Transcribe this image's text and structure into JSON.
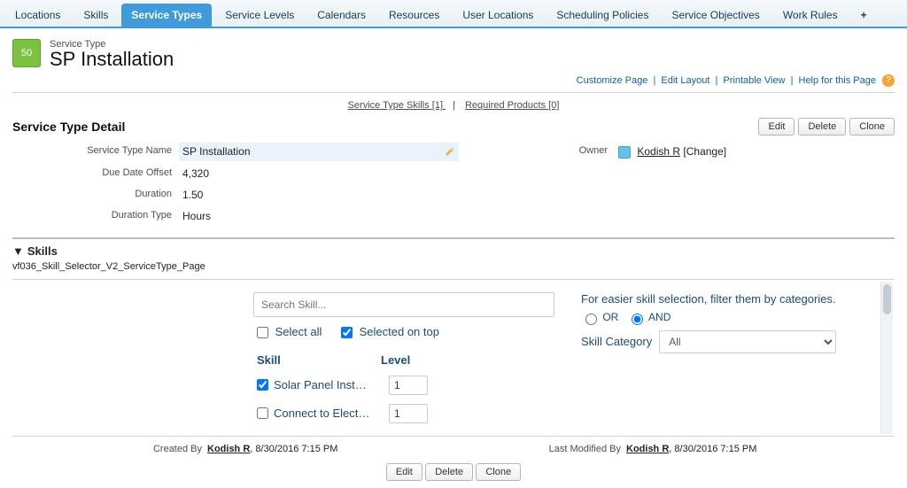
{
  "tabs": [
    "Locations",
    "Skills",
    "Service Types",
    "Service Levels",
    "Calendars",
    "Resources",
    "User Locations",
    "Scheduling Policies",
    "Service Objectives",
    "Work Rules",
    "+"
  ],
  "active_tab_index": 2,
  "record": {
    "object_label": "Service Type",
    "title": "SP Installation",
    "icon_text": "50"
  },
  "util_links": {
    "customize": "Customize Page",
    "edit_layout": "Edit Layout",
    "printable": "Printable View",
    "help": "Help for this Page"
  },
  "related_links": {
    "skills": {
      "label": "Service Type Skills",
      "count": "[1]"
    },
    "products": {
      "label": "Required Products",
      "count": "[0]"
    }
  },
  "section": {
    "title": "Service Type Detail"
  },
  "buttons": {
    "edit": "Edit",
    "delete": "Delete",
    "clone": "Clone"
  },
  "fields": {
    "name_label": "Service Type Name",
    "name_value": "SP Installation",
    "due_label": "Due Date Offset",
    "due_value": "4,320",
    "duration_label": "Duration",
    "duration_value": "1.50",
    "durtype_label": "Duration Type",
    "durtype_value": "Hours",
    "owner_label": "Owner",
    "owner_value": "Kodish R",
    "owner_change": "[Change]"
  },
  "skills_section": {
    "header": "Skills",
    "vf_name": "vf036_Skill_Selector_V2_ServiceType_Page"
  },
  "selector": {
    "search_placeholder": "Search Skill...",
    "select_all": "Select all",
    "selected_on_top": "Selected on top",
    "col_skill": "Skill",
    "col_level": "Level",
    "items": [
      {
        "checked": true,
        "name": "Solar Panel Inst…",
        "level": "1"
      },
      {
        "checked": false,
        "name": "Connect to Elect…",
        "level": "1"
      }
    ],
    "filter_note": "For easier skill selection, filter them by categories.",
    "or": "OR",
    "and": "AND",
    "category_label": "Skill Category",
    "category_value": "All"
  },
  "audit": {
    "created_label": "Created By",
    "created_user": "Kodish R",
    "created_at": "8/30/2016 7:15 PM",
    "modified_label": "Last Modified By",
    "modified_user": "Kodish R",
    "modified_at": "8/30/2016 7:15 PM"
  }
}
